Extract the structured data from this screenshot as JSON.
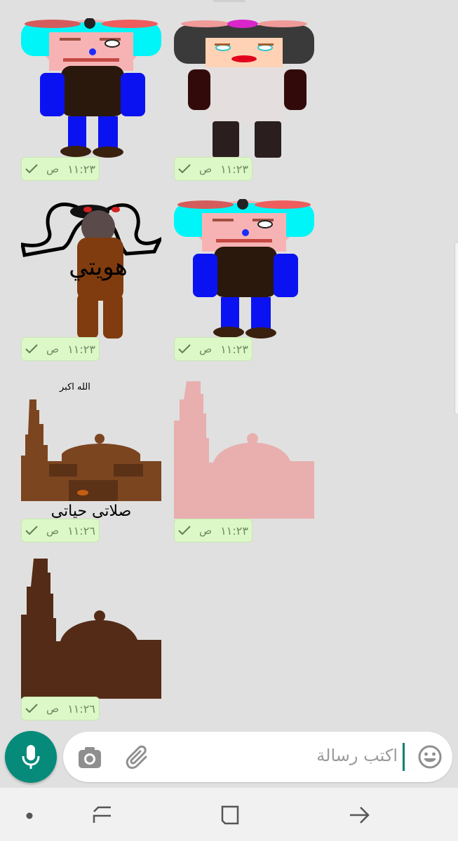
{
  "messages": [
    {
      "sticker": "boy-character-sticker",
      "time": "١١:٢٣",
      "suffix": "ص"
    },
    {
      "sticker": "girl-character-sticker",
      "time": "١١:٢٣",
      "suffix": "ص"
    },
    {
      "sticker": "hawiyati-character-sticker",
      "time": "١١:٢٣",
      "suffix": "ص",
      "text": "هويتي"
    },
    {
      "sticker": "boy-character-sticker",
      "time": "١١:٢٣",
      "suffix": "ص"
    },
    {
      "sticker": "mosque-brown-sticker",
      "time": "١١:٢٦",
      "suffix": "ص",
      "top_text": "الله اكبر",
      "bottom_text": "صلاتي حياتي"
    },
    {
      "sticker": "mosque-pink-sticker",
      "time": "١١:٢٣",
      "suffix": "ص"
    },
    {
      "sticker": "mosque-dark-sticker",
      "time": "١١:٢٦",
      "suffix": "ص"
    }
  ],
  "composer": {
    "placeholder": "اكتب رسالة"
  },
  "icons": {
    "emoji": "smiley-icon",
    "attach": "paperclip-icon",
    "camera": "camera-icon",
    "mic": "microphone-icon",
    "tick": "check-icon"
  },
  "colors": {
    "background": "#e0e0e0",
    "bubble": "#dcf8c6",
    "mic_button": "#068b7b",
    "caret": "#0a7f72"
  }
}
